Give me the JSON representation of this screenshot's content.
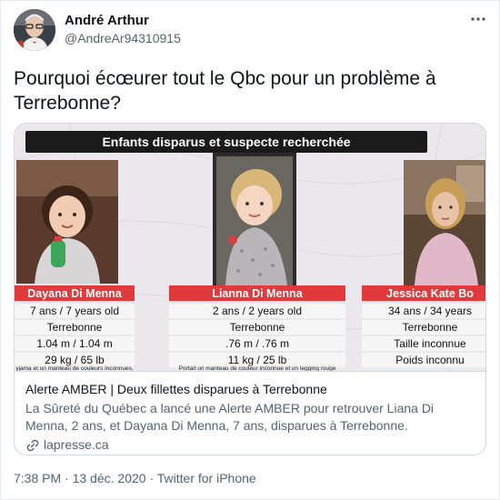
{
  "author": {
    "name": "André Arthur",
    "handle": "@AndreAr94310915"
  },
  "tweet": {
    "text": "Pourquoi écœurer tout le Qbc pour un problème à Terrebonne?",
    "time": "7:38 PM",
    "date": "13 déc. 2020",
    "source": "Twitter for iPhone",
    "separator": "·"
  },
  "card": {
    "image": {
      "banner": "Enfants disparus et suspecte recherchée",
      "people": [
        {
          "name": "Dayana Di Menna",
          "age": "7 ans / 7 years old",
          "city": "Terrebonne",
          "height": "1.04 m / 1.04 m",
          "weight": "29 kg / 65 lb",
          "note": "yjama et un manteau de couleurs inconnues,"
        },
        {
          "name": "Lianna Di Menna",
          "age": "2 ans / 2 years old",
          "city": "Terrebonne",
          "height": ".76 m / .76 m",
          "weight": "11 kg / 25 lb",
          "note": "Portait un manteau de couleur inconnue et un legging rouge"
        },
        {
          "name": "Jessica Kate Bo",
          "age": "34 ans / 34 years",
          "city": "Terrebonne",
          "height": "Taille inconnue",
          "weight": "Poids inconnu",
          "note": ""
        }
      ]
    },
    "title": "Alerte AMBER | Deux fillettes disparues à Terrebonne",
    "description": "La Sûreté du Québec a lancé une Alerte AMBER pour retrouver Liana Di Menna, 2 ans, et Dayana Di Menna, 7 ans, disparues à Terrebonne.",
    "domain": "lapresse.ca"
  },
  "icons": {
    "more": "more-icon",
    "link": "link-icon"
  },
  "colors": {
    "name_bar": "#e03a3c",
    "banner": "#1a1a1a",
    "secondary_text": "#536471"
  }
}
